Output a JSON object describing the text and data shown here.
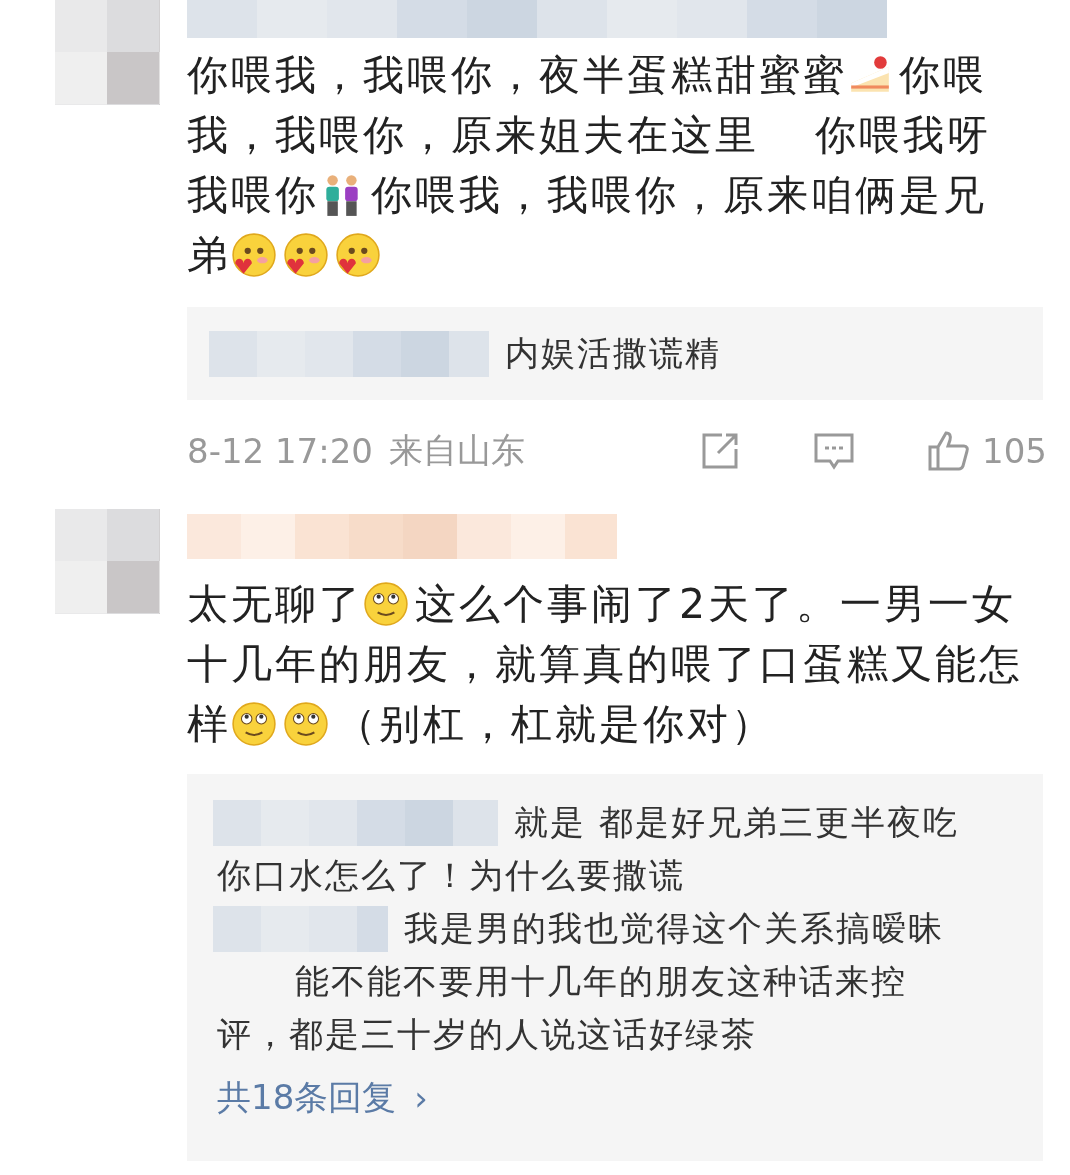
{
  "comments": [
    {
      "lines": [
        [
          {
            "kind": "text",
            "text": "你喂我，我喂你，夜半蛋糕甜蜜蜜"
          },
          {
            "kind": "cake"
          },
          {
            "kind": "text",
            "text": "你喂"
          }
        ],
        [
          {
            "kind": "text",
            "text": "我，我喂你，原来姐夫在这里"
          },
          {
            "kind": "text",
            "text": "你喂我呀"
          }
        ],
        [
          {
            "kind": "text",
            "text": "我喂你"
          },
          {
            "kind": "couple"
          },
          {
            "kind": "text",
            "text": "你喂我，我喂你，原来咱俩是兄"
          }
        ],
        [
          {
            "kind": "text",
            "text": "弟"
          },
          {
            "kind": "blush"
          },
          {
            "kind": "blush"
          },
          {
            "kind": "blush"
          }
        ]
      ],
      "replies": [
        {
          "lines": [
            "内娱活撒谎精"
          ]
        }
      ],
      "time": "8-12 17:20",
      "location": "来自山东",
      "likes": "105"
    },
    {
      "lines": [
        [
          {
            "kind": "text",
            "text": "太无聊了"
          },
          {
            "kind": "smirk"
          },
          {
            "kind": "text",
            "text": "这么个事闹了2天了。一男一女"
          }
        ],
        [
          {
            "kind": "text",
            "text": "十几年的朋友，就算真的喂了口蛋糕又能怎"
          }
        ],
        [
          {
            "kind": "text",
            "text": "样"
          },
          {
            "kind": "smirk"
          },
          {
            "kind": "smirk"
          },
          {
            "kind": "text",
            "text": "（别杠，杠就是你对）"
          }
        ]
      ],
      "replies": [
        {
          "lines": [
            "就是 都是好兄弟三更半夜吃",
            "你口水怎么了！为什么要撒谎"
          ]
        },
        {
          "lines": [
            "我是男的我也觉得这个关系搞暧昧",
            "能不能不要用十几年的朋友这种话来控",
            "评，都是三十岁的人说这话好绿茶"
          ]
        }
      ],
      "more_replies": "共18条回复",
      "more_arrow": "›"
    }
  ]
}
